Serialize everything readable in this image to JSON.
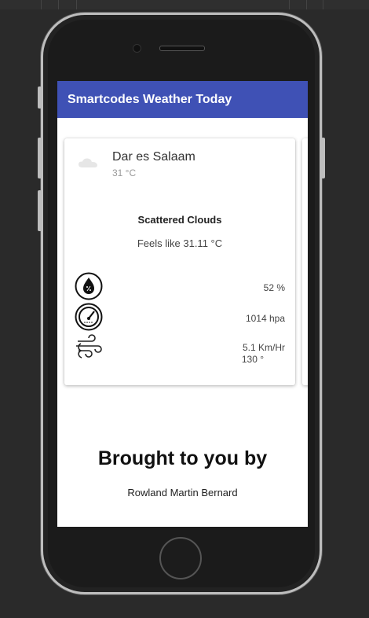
{
  "app": {
    "title": "Smartcodes Weather Today"
  },
  "weather": {
    "city": "Dar es Salaam",
    "temperature": "31 °C",
    "description": "Scattered Clouds",
    "feels_like": "Feels like 31.11 °C",
    "humidity": "52 %",
    "pressure": "1014 hpa",
    "wind_speed": "5.1 Km/Hr",
    "wind_direction": "130 °"
  },
  "footer": {
    "title": "Brought to you by",
    "author": "Rowland Martin Bernard"
  },
  "icons": {
    "condition": "cloud-icon",
    "humidity": "humidity-icon",
    "pressure": "pressure-gauge-icon",
    "wind": "wind-icon"
  },
  "colors": {
    "app_bar": "#3f51b5",
    "background": "#2a2a2a"
  }
}
